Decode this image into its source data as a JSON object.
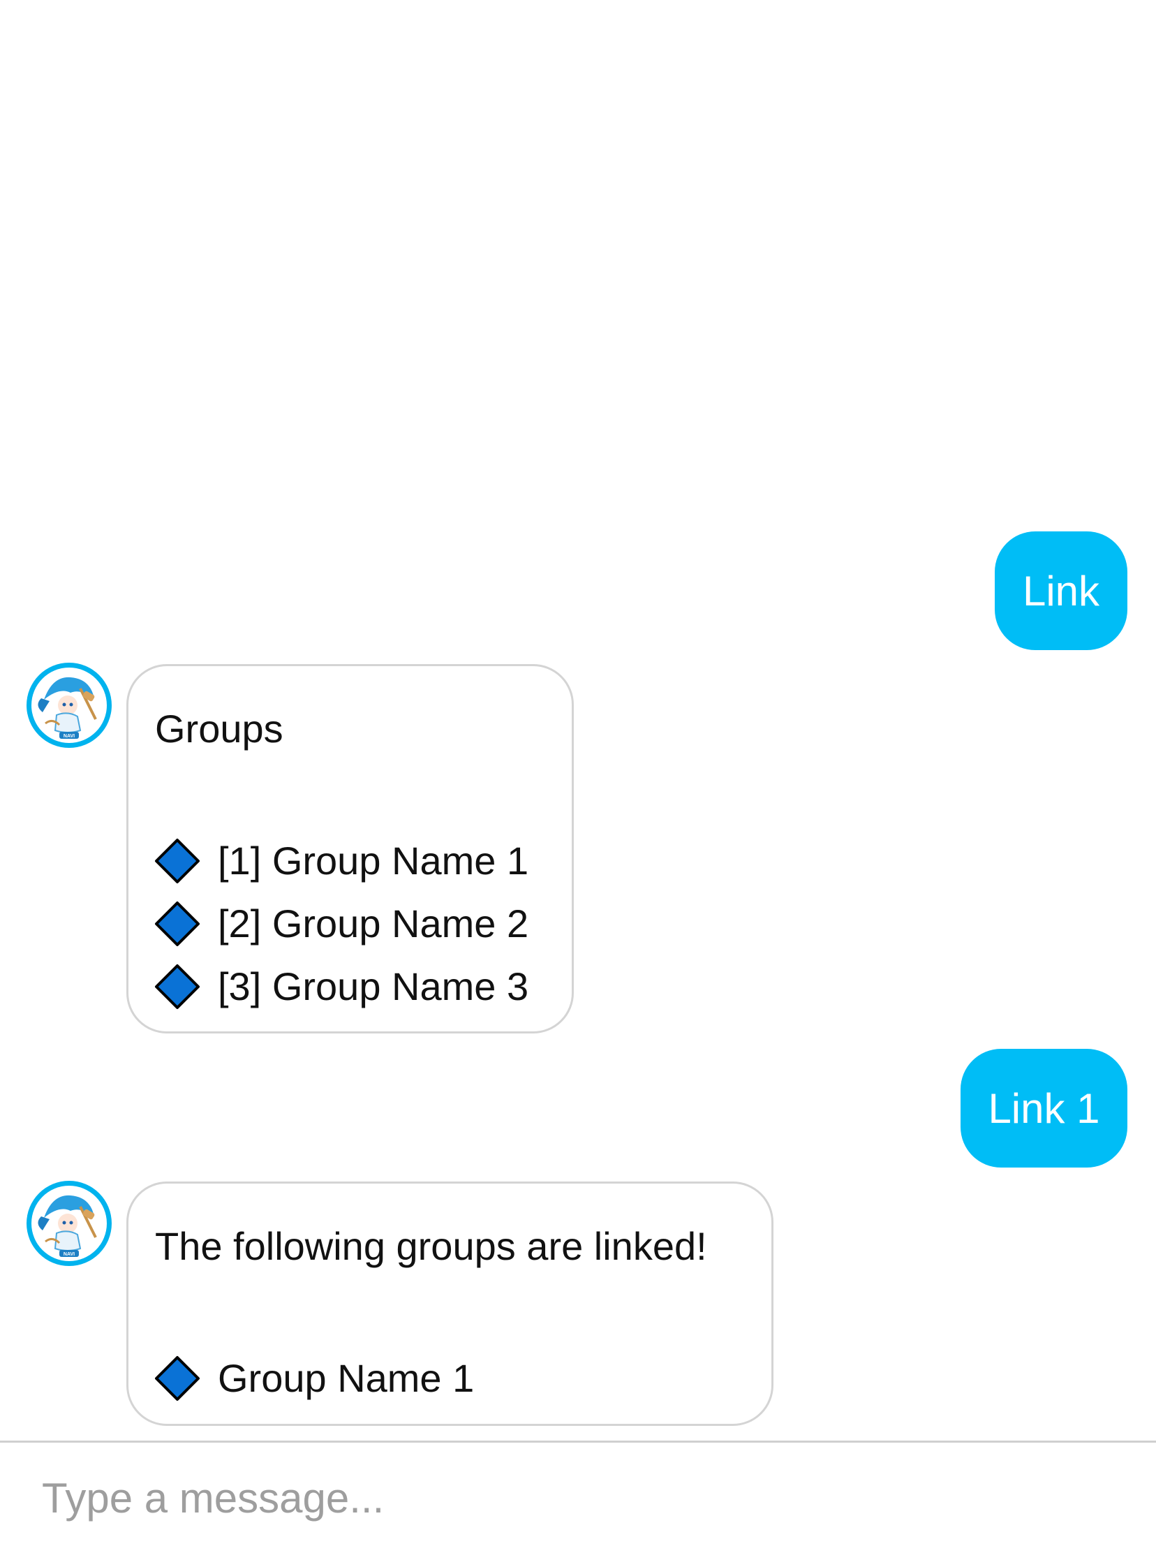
{
  "messages": [
    {
      "sender": "user",
      "text": "Link"
    },
    {
      "sender": "bot",
      "title": "Groups",
      "items": [
        "[1] Group Name 1",
        "[2] Group Name 2",
        "[3] Group Name 3"
      ]
    },
    {
      "sender": "user",
      "text": "Link 1"
    },
    {
      "sender": "bot",
      "title": "The following groups are linked!",
      "items": [
        "Group Name 1"
      ]
    }
  ],
  "avatar": {
    "label": "NAVI"
  },
  "input": {
    "placeholder": "Type a message...",
    "value": ""
  },
  "colors": {
    "user_bubble": "#00bdf6",
    "bot_border": "#d4d4d4",
    "diamond_fill": "#0a72d6",
    "avatar_ring": "#00b3ee"
  },
  "icons": {
    "list_bullet": "blue-diamond-icon"
  }
}
